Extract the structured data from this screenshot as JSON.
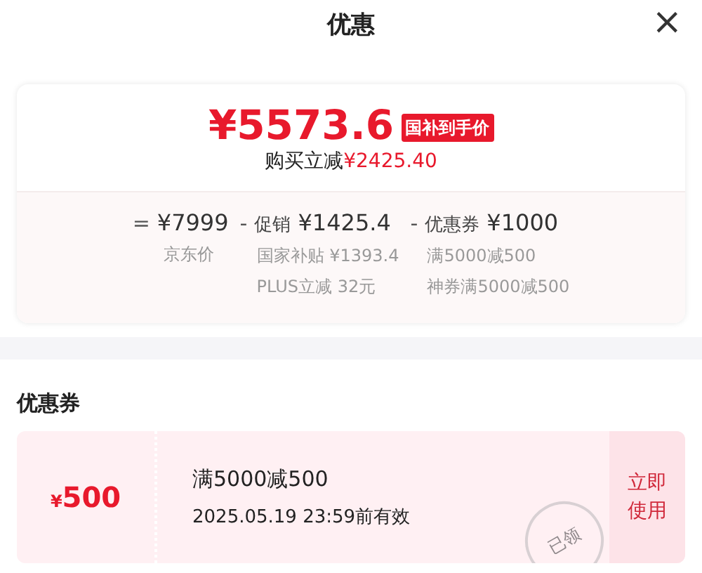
{
  "header": {
    "title": "优惠",
    "close": "×"
  },
  "price_card": {
    "price": "¥5573.6",
    "price_tag": "国补到手价",
    "saving_label": "购买立减",
    "saving_amount": "¥2425.40",
    "breakdown": [
      {
        "operator": "=",
        "amount": "¥7999",
        "details": [
          "京东价"
        ]
      },
      {
        "operator": "-",
        "label": "促销",
        "amount": "¥1425.4",
        "details": [
          "国家补贴 ¥1393.4",
          "PLUS立减 32元"
        ]
      },
      {
        "operator": "-",
        "label": "优惠券",
        "amount": "¥1000",
        "details": [
          "满5000减500",
          "神券满5000减500"
        ]
      }
    ]
  },
  "coupons_section": {
    "title": "优惠券",
    "coupons": [
      {
        "currency": "¥",
        "value": "500",
        "condition": "满5000减500",
        "validity": "2025.05.19 23:59前有效",
        "stamp": "已领",
        "action": "立即使用"
      }
    ]
  }
}
